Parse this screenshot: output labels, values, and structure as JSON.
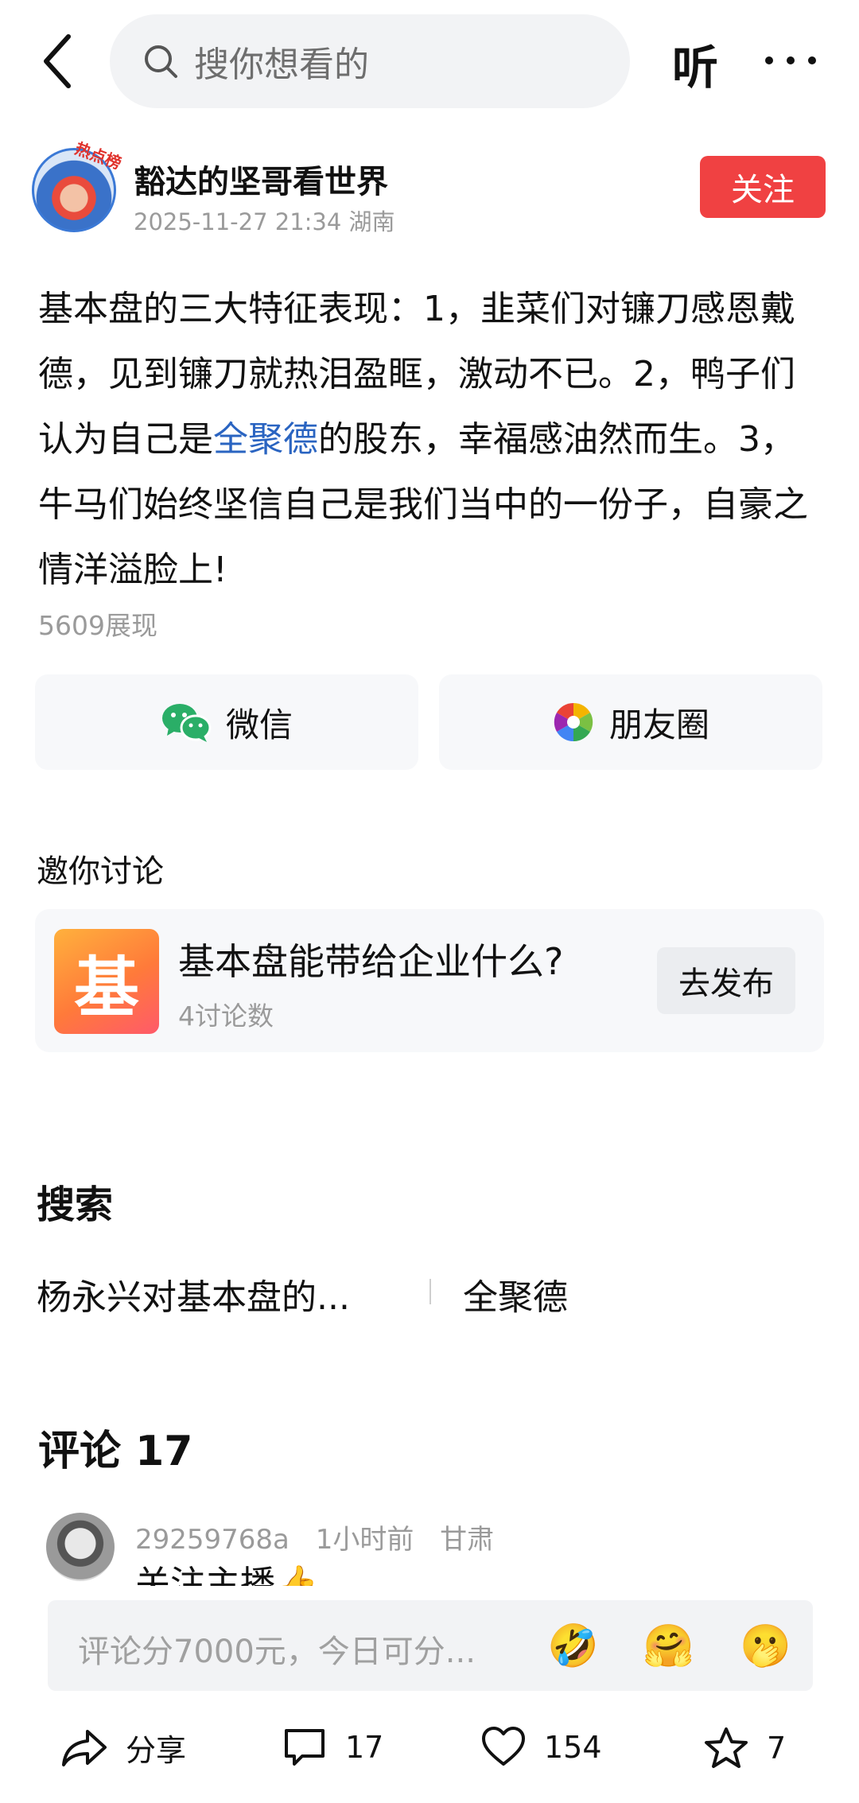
{
  "topbar": {
    "search_placeholder": "搜你想看的",
    "listen_label": "听"
  },
  "author": {
    "name": "豁达的坚哥看世界",
    "datetime": "2025-11-27 21:34",
    "location": "湖南",
    "avatar_badge": "热点榜",
    "follow_label": "关注"
  },
  "post": {
    "text_before": "基本盘的三大特征表现：1，韭菜们对镰刀感恩戴德，见到镰刀就热泪盈眶，激动不已。2，鸭子们认为自己是",
    "link_text": "全聚德",
    "text_after": "的股东，幸福感油然而生。3，牛马们始终坚信自己是我们当中的一份子，自豪之情洋溢脸上!",
    "views": "5609展现"
  },
  "share": {
    "wechat_label": "微信",
    "moments_label": "朋友圈"
  },
  "discussion": {
    "title": "邀你讨论",
    "logo_char": "基",
    "question": "基本盘能带给企业什么?",
    "count": "4讨论数",
    "button_label": "去发布"
  },
  "search_section": {
    "title": "搜索",
    "suggestions": [
      "杨永兴对基本盘的...",
      "全聚德"
    ]
  },
  "comments": {
    "title": "评论 17",
    "first": {
      "user": "29259768a",
      "time": "1小时前",
      "location": "甘肃",
      "text": "关注主播👍"
    },
    "input_placeholder": "评论分7000元，今日可分...",
    "emojis": [
      "🤣",
      "🤗",
      "🫢"
    ]
  },
  "actions": {
    "share_label": "分享",
    "comment_count": "17",
    "like_count": "154",
    "fav_count": "7"
  },
  "colors": {
    "accent_red": "#f04142",
    "link_blue": "#2a64c1",
    "muted_text": "#9a9a9a"
  }
}
